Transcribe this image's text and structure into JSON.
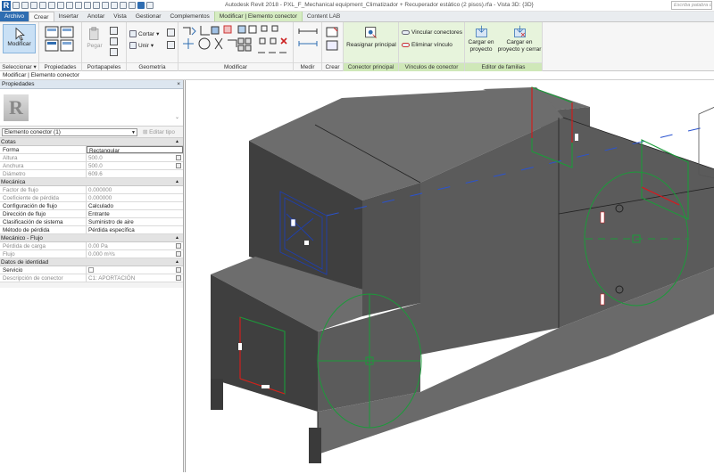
{
  "window": {
    "title": "Autodesk Revit 2018 -    PXL_F_Mechanical equipment_Climatizador + Recuperador estático (2 pisos).rfa - Vista 3D: {3D}",
    "search_placeholder": "Escriba palabra clave"
  },
  "tabs": [
    "Archivo",
    "Crear",
    "Insertar",
    "Anotar",
    "Vista",
    "Gestionar",
    "Complementos",
    "Modificar | Elemento conector",
    "Content LAB"
  ],
  "ribbon": {
    "select": {
      "button": "Modificar",
      "label": "Seleccionar ▾"
    },
    "properties_label": "Propiedades",
    "clipboard": {
      "paste": "Pegar",
      "label": "Portapapeles"
    },
    "geometry": {
      "cut": "Cortar",
      "join": "Unir",
      "label": "Geometría"
    },
    "modify_label": "Modificar",
    "measure_label": "Medir",
    "create_label": "Crear",
    "main_connector": {
      "button": "Reasignar principal",
      "label": "Conector principal"
    },
    "connector_links": {
      "link": "Vincular conectores",
      "unlink": "Eliminar vínculo",
      "label": "Vínculos de conector"
    },
    "family_editor": {
      "load": "Cargar en proyecto",
      "load_close": "Cargar en proyecto y cerrar",
      "label": "Editor de familias"
    }
  },
  "breadcrumb": "Modificar | Elemento conector",
  "properties": {
    "header": "Propiedades",
    "close": "×",
    "type_selector": "Elemento conector (1)",
    "edit_type": "Editar tipo",
    "sections": [
      {
        "name": "Cotas",
        "rows": [
          {
            "key": "Forma",
            "value": "Rectangular",
            "ro": false,
            "edit": true
          },
          {
            "key": "Altura",
            "value": "500.0",
            "ro": true,
            "btn": true
          },
          {
            "key": "Anchura",
            "value": "500.0",
            "ro": true,
            "btn": true
          },
          {
            "key": "Diámetro",
            "value": "609.6",
            "ro": true
          }
        ]
      },
      {
        "name": "Mecánica",
        "rows": [
          {
            "key": "Factor de flujo",
            "value": "0.000000",
            "ro": true
          },
          {
            "key": "Coeficiente de pérdida",
            "value": "0.000000",
            "ro": true
          },
          {
            "key": "Configuración de flujo",
            "value": "Calculado",
            "ro": false
          },
          {
            "key": "Dirección de flujo",
            "value": "Entrante",
            "ro": false
          },
          {
            "key": "Clasificación de sistema",
            "value": "Suministro de aire",
            "ro": false
          },
          {
            "key": "Método de pérdida",
            "value": "Pérdida específica",
            "ro": false
          }
        ]
      },
      {
        "name": "Mecánico - Flujo",
        "rows": [
          {
            "key": "Pérdida de carga",
            "value": "0.00 Pa",
            "ro": true,
            "btn": true
          },
          {
            "key": "Flujo",
            "value": "0.000 m³/s",
            "ro": true,
            "btn": true
          }
        ]
      },
      {
        "name": "Datos de identidad",
        "rows": [
          {
            "key": "Servicio",
            "value": "",
            "ro": false,
            "check": true,
            "btn": true
          },
          {
            "key": "Descripción de conector",
            "value": "C1: APORTACIÓN",
            "ro": true,
            "btn": true
          }
        ]
      }
    ]
  },
  "colors": {
    "accent": "#2f6db1",
    "context_tab": "#d6ecc2",
    "model_face_front": "#3f3f3f",
    "model_face_side": "#5b5b5b",
    "model_face_top": "#6d6d6d",
    "connector_blue": "#1e3fb0",
    "connector_green": "#1b9b3a",
    "connector_red": "#e0141a"
  }
}
